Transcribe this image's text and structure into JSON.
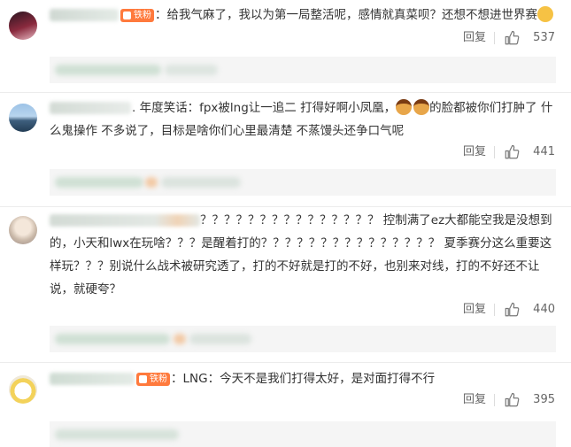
{
  "comments": [
    {
      "fan_badge": "铁粉",
      "text": "给我气麻了，我以为第一局整活呢，感情就真菜呗？还想不想进世界赛",
      "reply_label": "回复",
      "likes": "537"
    },
    {
      "text": "年度笑话：fpx被lng让一追二  打得好啊小凤凰，",
      "text_after_emoji": "的脸都被你们打肿了 什么鬼操作 不多说了，目标是啥你们心里最清楚  不蒸馒头还争口气呢",
      "reply_label": "回复",
      "likes": "441"
    },
    {
      "text": "？？？？？？？？？？？？？？？ 控制满了ez大都能空我是没想到的，小天和lwx在玩啥？？？是醒着打的？？？？？？？？？？？？？？？ 夏季赛分这么重要这样玩？？？别说什么战术被研究透了，打的不好就是打的不好，也别来对线，打的不好还不让说，就硬夸？",
      "reply_label": "回复",
      "likes": "440"
    },
    {
      "fan_badge": "铁粉",
      "text": "LNG：今天不是我们打得太好，是对面打得不行",
      "reply_label": "回复",
      "likes": "395"
    }
  ],
  "icons": {
    "like": "thumbs-up-icon",
    "emoji_face": "flushed-face-emoji",
    "emoji_girl": "woman-emoji"
  },
  "colors": {
    "badge": "#ff7a3d",
    "text": "#333333",
    "meta": "#666666",
    "subreply_bg": "#f5f5f5"
  }
}
